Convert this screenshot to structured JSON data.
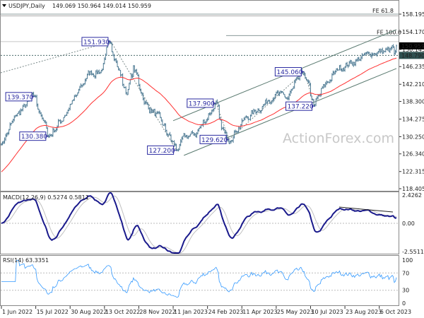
{
  "header": {
    "symbol": "USDJPY,Daily",
    "ohlc": "149.069 150.964 149.014 150.959"
  },
  "watermark": "ActionForex.com",
  "chart_data": {
    "type": "ohlc",
    "price_axis": {
      "range": [
        118.405,
        158.195
      ],
      "ticks": [
        "158.195",
        "154.170",
        "150.145",
        "146.235",
        "142.210",
        "138.300",
        "134.275",
        "130.250",
        "126.340",
        "122.315",
        "118.405"
      ]
    },
    "date_axis": {
      "ticks": [
        "1 Jun 2022",
        "15 Jul 2022",
        "30 Aug 2022",
        "13 Oct 2022",
        "28 Nov 2022",
        "11 Jan 2023",
        "24 Feb 2023",
        "11 Apr 2023",
        "25 May 2023",
        "10 Jul 2023",
        "23 Aug 2023",
        "6 Oct 2023"
      ]
    },
    "current_price": "150.959",
    "marked_level": "148.790",
    "bar_color": "#4f7b94",
    "moving_average_color": "#ff3030",
    "close_path": [
      [
        "2022-06-01",
        128.5
      ],
      [
        "2022-06-20",
        135.0
      ],
      [
        "2022-07-14",
        139.37
      ],
      [
        "2022-08-02",
        130.38
      ],
      [
        "2022-08-18",
        134.0
      ],
      [
        "2022-09-07",
        139.5
      ],
      [
        "2022-09-22",
        144.5
      ],
      [
        "2022-10-10",
        145.5
      ],
      [
        "2022-10-21",
        151.93
      ],
      [
        "2022-10-28",
        148.0
      ],
      [
        "2022-11-11",
        140.0
      ],
      [
        "2022-11-21",
        146.0
      ],
      [
        "2022-12-05",
        138.0
      ],
      [
        "2022-12-21",
        135.0
      ],
      [
        "2023-01-16",
        127.2
      ],
      [
        "2023-01-26",
        130.0
      ],
      [
        "2023-02-10",
        131.0
      ],
      [
        "2023-03-08",
        137.9
      ],
      [
        "2023-03-15",
        132.0
      ],
      [
        "2023-03-24",
        129.62
      ],
      [
        "2023-04-13",
        134.0
      ],
      [
        "2023-05-08",
        137.5
      ],
      [
        "2023-05-23",
        140.0
      ],
      [
        "2023-06-09",
        139.0
      ],
      [
        "2023-06-30",
        145.06
      ],
      [
        "2023-07-14",
        137.22
      ],
      [
        "2023-07-28",
        142.0
      ],
      [
        "2023-08-16",
        146.0
      ],
      [
        "2023-09-05",
        147.5
      ],
      [
        "2023-09-29",
        149.5
      ],
      [
        "2023-10-20",
        149.8
      ],
      [
        "2023-10-25",
        150.5
      ],
      [
        "2023-10-26",
        148.8
      ],
      [
        "2023-10-30",
        150.959
      ]
    ],
    "swing_labels": [
      {
        "date": "2022-10-21",
        "price": 151.93,
        "label": "151.930"
      },
      {
        "date": "2022-07-14",
        "price": 139.37,
        "label": "139.370"
      },
      {
        "date": "2022-08-02",
        "price": 130.38,
        "label": "130.380"
      },
      {
        "date": "2023-01-16",
        "price": 127.2,
        "label": "127.200"
      },
      {
        "date": "2023-03-08",
        "price": 137.9,
        "label": "137.900"
      },
      {
        "date": "2023-03-24",
        "price": 129.62,
        "label": "129.620"
      },
      {
        "date": "2023-06-30",
        "price": 145.06,
        "label": "145.060"
      },
      {
        "date": "2023-07-14",
        "price": 137.22,
        "label": "137.220"
      }
    ],
    "fib_levels": [
      {
        "label": "FE 61.8",
        "price": 158.195
      },
      {
        "label": "FE 100.0",
        "price": 153.3
      }
    ],
    "horizontal_levels": [
      151.93,
      148.79
    ],
    "channel": {
      "upper": [
        [
          "2023-01-11",
          133.9
        ],
        [
          "2023-10-30",
          154.65
        ]
      ],
      "lower": [
        [
          "2023-01-25",
          126.0
        ],
        [
          "2023-10-30",
          145.8
        ]
      ]
    },
    "macd": {
      "label": "MACD(12,26,9) 0.5274 0.5811",
      "range": [
        -2.5511,
        2.4262
      ],
      "ticks": [
        "2.4262",
        "0.00",
        "-2.5511"
      ],
      "line_color": "#1a1a8c",
      "signal_color": "#c0c0c0"
    },
    "rsi": {
      "label": "RSI(14) 63.3351",
      "ticks": [
        "100",
        "70",
        "30",
        "0"
      ],
      "levels": [
        70,
        30
      ],
      "color": "#3399ff"
    }
  }
}
